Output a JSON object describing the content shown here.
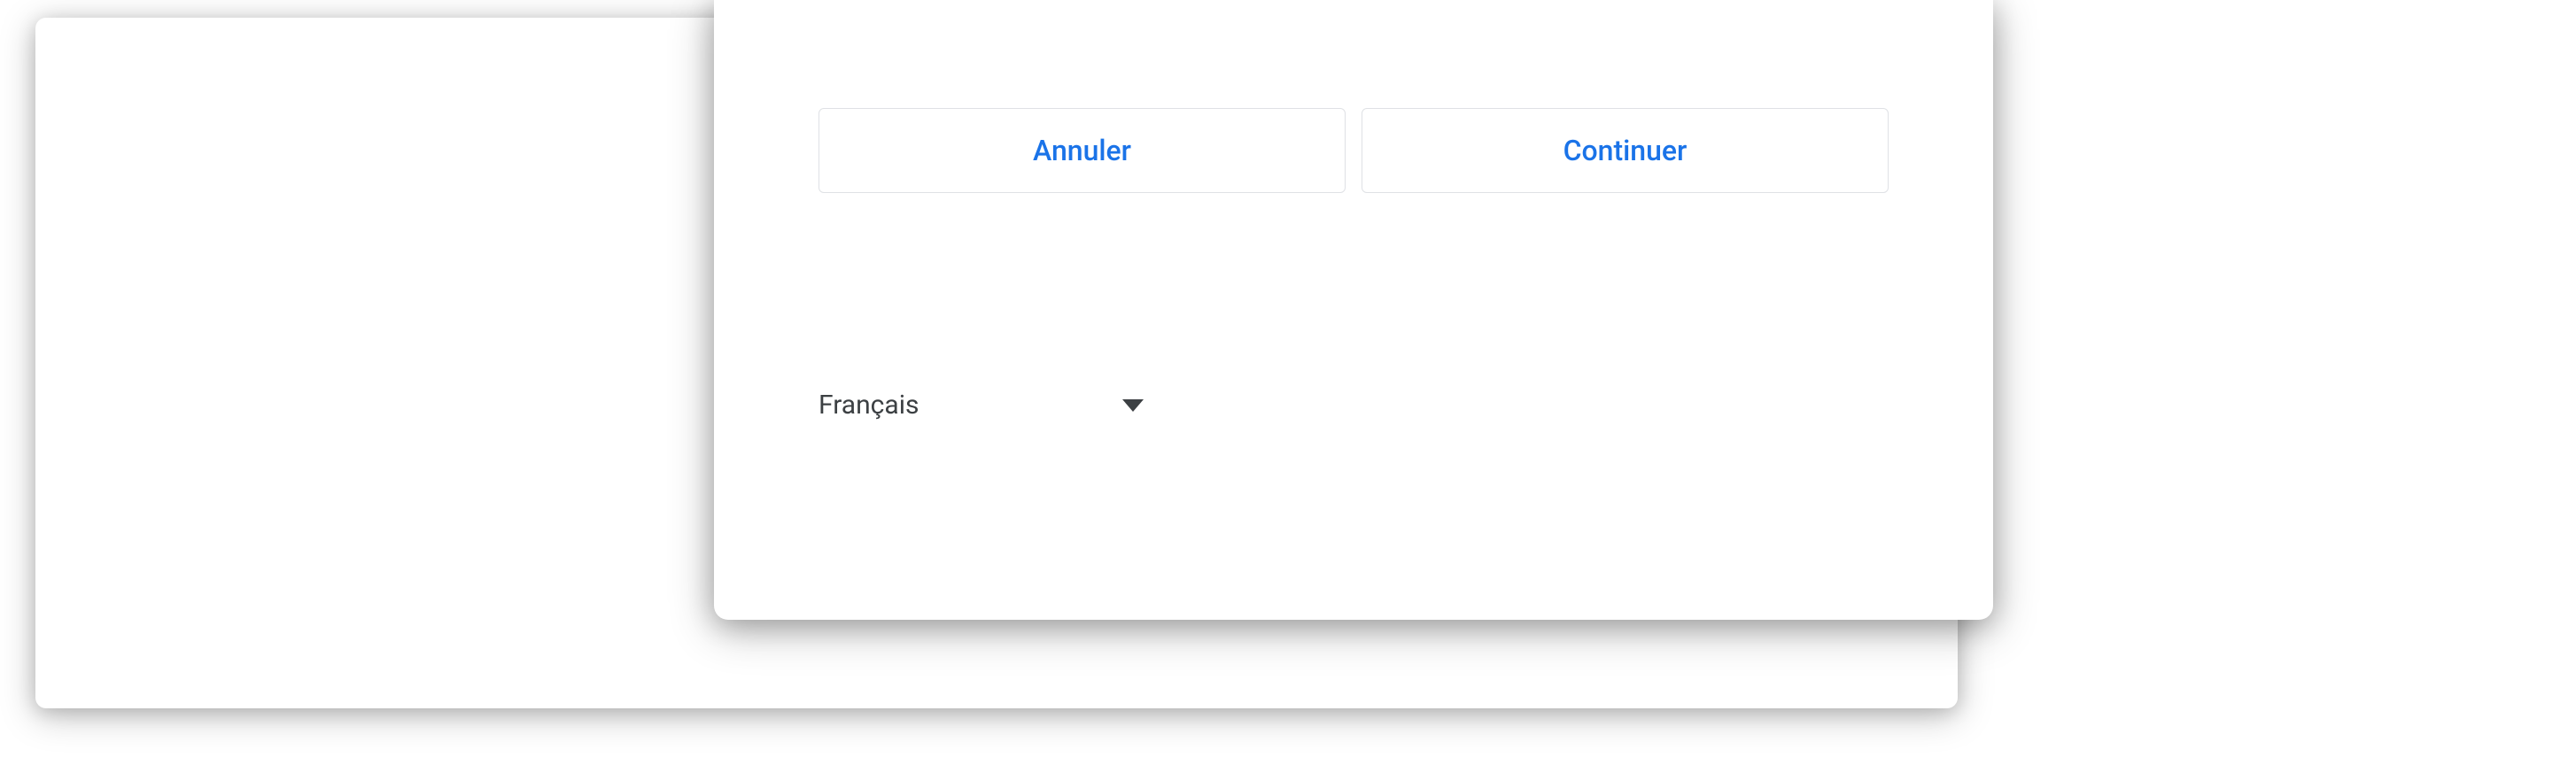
{
  "buttons": {
    "cancel": "Annuler",
    "continue": "Continuer"
  },
  "language": {
    "selected": "Français"
  }
}
